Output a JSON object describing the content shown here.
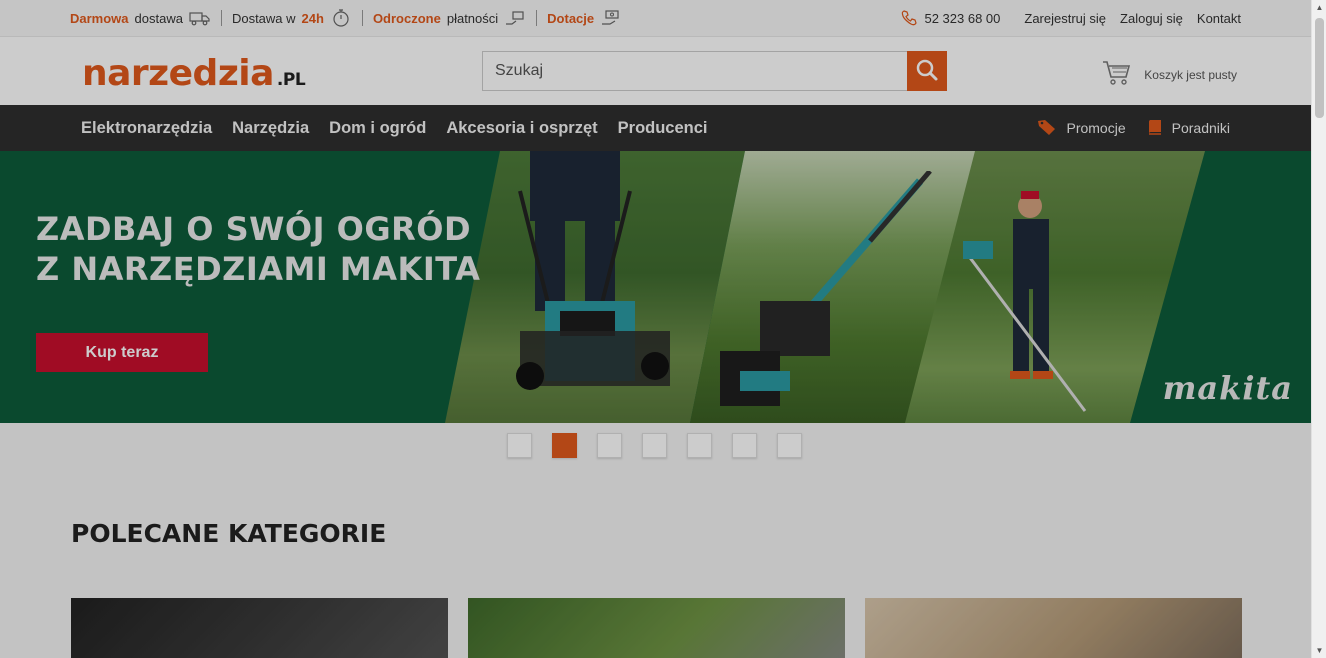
{
  "topbar": {
    "free_delivery_hl": "Darmowa",
    "free_delivery_rest": "dostawa",
    "delivery_prefix": "Dostawa w",
    "delivery_time": "24h",
    "deferred_hl": "Odroczone",
    "deferred_rest": "płatności",
    "grants": "Dotacje",
    "phone": "52 323 68 00",
    "register": "Zarejestruj się",
    "login": "Zaloguj się",
    "contact": "Kontakt"
  },
  "header": {
    "logo_main": "narzedzia",
    "logo_suffix": ".PL",
    "search_placeholder": "Szukaj",
    "cart_text": "Koszyk jest pusty"
  },
  "nav": {
    "items": [
      "Elektronarzędzia",
      "Narzędzia",
      "Dom i ogród",
      "Akcesoria i osprzęt",
      "Producenci"
    ],
    "promotions": "Promocje",
    "guides": "Poradniki"
  },
  "banner": {
    "line1": "ZADBAJ O SWÓJ OGRÓD",
    "line2": "Z NARZĘDZIAMI MAKITA",
    "cta": "Kup teraz",
    "brand": "makita"
  },
  "carousel": {
    "slides": 7,
    "active_index": 1
  },
  "section": {
    "title": "POLECANE KATEGORIE"
  },
  "colors": {
    "accent": "#e0591c",
    "nav_bg": "#2f2f2f",
    "banner_bg": "#0d5c3a",
    "cta_bg": "#c8102e"
  }
}
